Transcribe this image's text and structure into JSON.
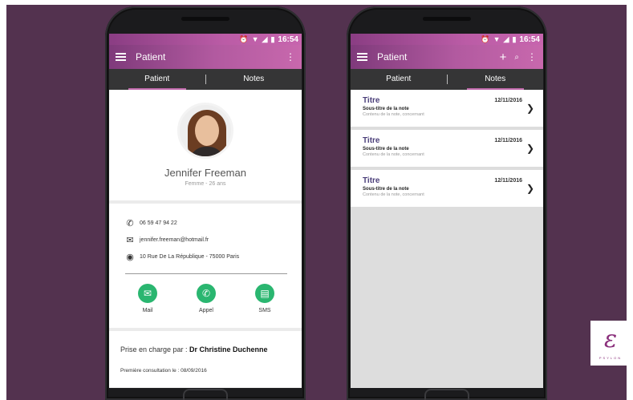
{
  "status": {
    "time": "16:54",
    "icons": [
      "alarm-icon",
      "wifi-icon",
      "signal-icon",
      "battery-icon"
    ]
  },
  "left": {
    "appbar": {
      "title": "Patient",
      "menu": "⋮"
    },
    "tabs": [
      "Patient",
      "Notes"
    ],
    "profile": {
      "name": "Jennifer Freeman",
      "subtitle": "Femme - 26 ans"
    },
    "contact": {
      "phone": "06 59 47 94 22",
      "email": "jennifer.freeman@hotmail.fr",
      "address": "10 Rue De La République - 75000 Paris"
    },
    "actions": [
      "Mail",
      "Appel",
      "SMS"
    ],
    "care": {
      "label": "Prise en charge par : ",
      "doctor": "Dr Christine Duchenne",
      "first_consult": "Première consultation le : 08/09/2016"
    }
  },
  "right": {
    "appbar": {
      "title": "Patient",
      "add": "+",
      "search": "🔍",
      "menu": "⋮"
    },
    "tabs": [
      "Patient",
      "Notes"
    ],
    "notes": [
      {
        "title": "Titre",
        "subtitle": "Sous-titre de la note",
        "content": "Contenu de la note, concernant",
        "date": "12/11/2016"
      },
      {
        "title": "Titre",
        "subtitle": "Sous-titre de la note",
        "content": "Contenu de la note, concernant",
        "date": "12/11/2016"
      },
      {
        "title": "Titre",
        "subtitle": "Sous-titre de la note",
        "content": "Contenu de la note, concernant",
        "date": "12/11/2016"
      }
    ]
  },
  "logo": {
    "text": "PSYLON"
  },
  "colors": {
    "accent": "#b25aa0",
    "action": "#2ab670",
    "tabbar": "#353536",
    "background": "#53324f"
  }
}
